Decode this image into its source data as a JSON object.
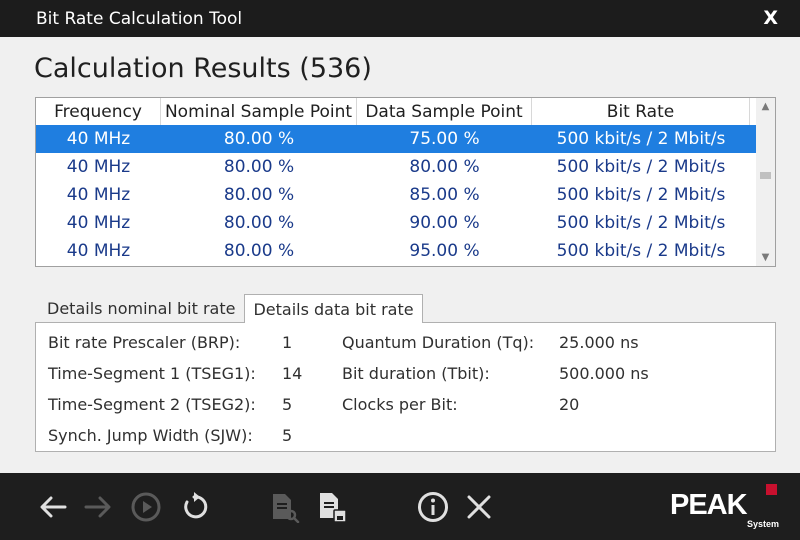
{
  "window": {
    "title": "Bit Rate Calculation Tool",
    "close_label": "X"
  },
  "results": {
    "title": "Calculation Results (536)",
    "columns": [
      "Frequency",
      "Nominal Sample Point",
      "Data Sample Point",
      "Bit Rate"
    ],
    "rows": [
      [
        "40 MHz",
        "80.00 %",
        "75.00 %",
        "500 kbit/s / 2 Mbit/s"
      ],
      [
        "40 MHz",
        "80.00 %",
        "80.00 %",
        "500 kbit/s / 2 Mbit/s"
      ],
      [
        "40 MHz",
        "80.00 %",
        "85.00 %",
        "500 kbit/s / 2 Mbit/s"
      ],
      [
        "40 MHz",
        "80.00 %",
        "90.00 %",
        "500 kbit/s / 2 Mbit/s"
      ],
      [
        "40 MHz",
        "80.00 %",
        "95.00 %",
        "500 kbit/s / 2 Mbit/s"
      ]
    ],
    "selected_row": 0
  },
  "tabs": [
    {
      "label": "Details nominal bit rate",
      "active": false
    },
    {
      "label": "Details data bit rate",
      "active": true
    }
  ],
  "details": {
    "brp_label": "Bit rate Prescaler (BRP):",
    "brp_value": "1",
    "tseg1_label": "Time-Segment 1 (TSEG1):",
    "tseg1_value": "14",
    "tseg2_label": "Time-Segment 2 (TSEG2):",
    "tseg2_value": "5",
    "sjw_label": "Synch. Jump Width (SJW):",
    "sjw_value": "5",
    "tq_label": "Quantum Duration (Tq):",
    "tq_value": "25.000 ns",
    "tbit_label": "Bit duration (Tbit):",
    "tbit_value": "500.000 ns",
    "cpb_label": "Clocks per Bit:",
    "cpb_value": "20"
  },
  "toolbar": {
    "icons": [
      "back-arrow-icon",
      "forward-arrow-icon",
      "play-icon",
      "reset-icon",
      "document-search-icon",
      "document-save-icon",
      "info-icon",
      "close-icon"
    ],
    "colors": {
      "enabled": "#e0e0e0",
      "disabled": "#5a5a5a"
    }
  },
  "logo": {
    "name": "PEAK",
    "sub": "System",
    "accent": "#c8102e"
  },
  "colors": {
    "selection": "#1f7ee0",
    "row_text": "#1a3a8a"
  }
}
